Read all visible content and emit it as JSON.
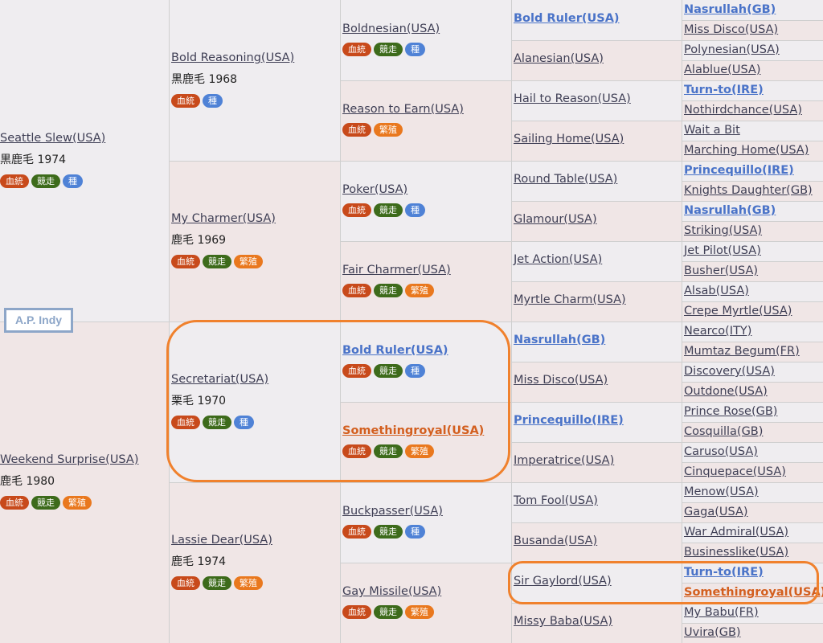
{
  "subject": "A.P. Indy",
  "badge_labels": {
    "blood": "血統",
    "race": "競走",
    "seed": "種",
    "breed": "繁殖"
  },
  "gen1": [
    {
      "name": "Seattle Slew(USA)",
      "info": "黒鹿毛 1974",
      "badges": [
        "blood",
        "race",
        "seed"
      ]
    },
    {
      "name": "Weekend Surprise(USA)",
      "info": "鹿毛 1980",
      "badges": [
        "blood",
        "race",
        "breed"
      ]
    }
  ],
  "gen2": [
    {
      "name": "Bold Reasoning(USA)",
      "info": "黒鹿毛 1968",
      "badges": [
        "blood",
        "seed"
      ]
    },
    {
      "name": "My Charmer(USA)",
      "info": "鹿毛 1969",
      "badges": [
        "blood",
        "race",
        "breed"
      ]
    },
    {
      "name": "Secretariat(USA)",
      "info": "栗毛 1970",
      "badges": [
        "blood",
        "race",
        "seed"
      ]
    },
    {
      "name": "Lassie Dear(USA)",
      "info": "鹿毛 1974",
      "badges": [
        "blood",
        "race",
        "breed"
      ]
    }
  ],
  "gen3": [
    {
      "name": "Boldnesian(USA)",
      "badges": [
        "blood",
        "race",
        "seed"
      ]
    },
    {
      "name": "Reason to Earn(USA)",
      "badges": [
        "blood",
        "breed"
      ]
    },
    {
      "name": "Poker(USA)",
      "badges": [
        "blood",
        "race",
        "seed"
      ]
    },
    {
      "name": "Fair Charmer(USA)",
      "badges": [
        "blood",
        "race",
        "breed"
      ]
    },
    {
      "name": "Bold Ruler(USA)",
      "style": "inbred",
      "badges": [
        "blood",
        "race",
        "seed"
      ]
    },
    {
      "name": "Somethingroyal(USA)",
      "style": "cross",
      "badges": [
        "blood",
        "race",
        "breed"
      ]
    },
    {
      "name": "Buckpasser(USA)",
      "badges": [
        "blood",
        "race",
        "seed"
      ]
    },
    {
      "name": "Gay Missile(USA)",
      "badges": [
        "blood",
        "race",
        "breed"
      ]
    }
  ],
  "gen4": [
    {
      "name": "Bold Ruler(USA)",
      "style": "inbred"
    },
    {
      "name": "Alanesian(USA)"
    },
    {
      "name": "Hail to Reason(USA)"
    },
    {
      "name": "Sailing Home(USA)"
    },
    {
      "name": "Round Table(USA)"
    },
    {
      "name": "Glamour(USA)"
    },
    {
      "name": "Jet Action(USA)"
    },
    {
      "name": "Myrtle Charm(USA)"
    },
    {
      "name": "Nasrullah(GB)",
      "style": "inbred"
    },
    {
      "name": "Miss Disco(USA)"
    },
    {
      "name": "Princequillo(IRE)",
      "style": "inbred"
    },
    {
      "name": "Imperatrice(USA)"
    },
    {
      "name": "Tom Fool(USA)"
    },
    {
      "name": "Busanda(USA)"
    },
    {
      "name": "Sir Gaylord(USA)"
    },
    {
      "name": "Missy Baba(USA)"
    }
  ],
  "gen5": [
    {
      "name": "Nasrullah(GB)",
      "style": "inbred"
    },
    {
      "name": "Miss Disco(USA)"
    },
    {
      "name": "Polynesian(USA)"
    },
    {
      "name": "Alablue(USA)"
    },
    {
      "name": "Turn-to(IRE)",
      "style": "inbred"
    },
    {
      "name": "Nothirdchance(USA)"
    },
    {
      "name": "Wait a Bit"
    },
    {
      "name": "Marching Home(USA)"
    },
    {
      "name": "Princequillo(IRE)",
      "style": "inbred"
    },
    {
      "name": "Knights Daughter(GB)"
    },
    {
      "name": "Nasrullah(GB)",
      "style": "inbred"
    },
    {
      "name": "Striking(USA)"
    },
    {
      "name": "Jet Pilot(USA)"
    },
    {
      "name": "Busher(USA)"
    },
    {
      "name": "Alsab(USA)"
    },
    {
      "name": "Crepe Myrtle(USA)"
    },
    {
      "name": "Nearco(ITY)"
    },
    {
      "name": "Mumtaz Begum(FR)"
    },
    {
      "name": "Discovery(USA)"
    },
    {
      "name": "Outdone(USA)"
    },
    {
      "name": "Prince Rose(GB)"
    },
    {
      "name": "Cosquilla(GB)"
    },
    {
      "name": "Caruso(USA)"
    },
    {
      "name": "Cinquepace(USA)"
    },
    {
      "name": "Menow(USA)"
    },
    {
      "name": "Gaga(USA)"
    },
    {
      "name": "War Admiral(USA)"
    },
    {
      "name": "Businesslike(USA)"
    },
    {
      "name": "Turn-to(IRE)",
      "style": "inbred"
    },
    {
      "name": "Somethingroyal(USA)",
      "style": "cross"
    },
    {
      "name": "My Babu(FR)"
    },
    {
      "name": "Uvira(GB)"
    }
  ]
}
